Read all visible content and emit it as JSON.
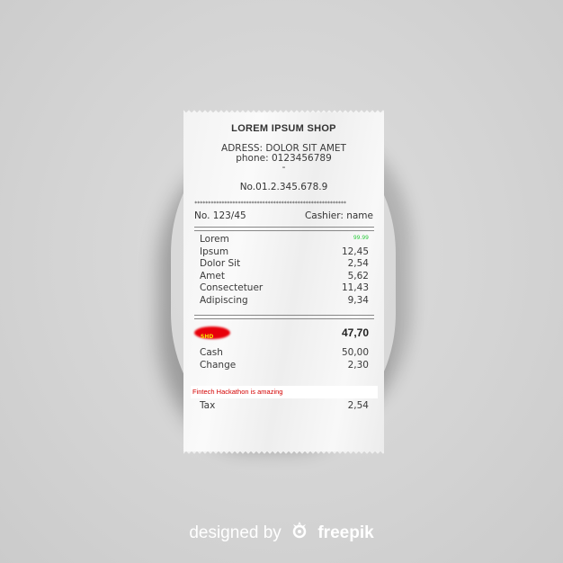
{
  "receipt": {
    "shop_name": "LOREM IPSUM SHOP",
    "address": "ADRESS: DOLOR SIT AMET",
    "phone": "phone: 0123456789",
    "dash": "-",
    "number": "No.01.2.345.678.9",
    "stars": "********************************************************",
    "doc_no": "No. 123/45",
    "cashier": "Cashier: name",
    "items": [
      {
        "name": "Lorem",
        "value": "99.99"
      },
      {
        "name": "Ipsum",
        "value": "12,45"
      },
      {
        "name": "Dolor Sit",
        "value": "2,54"
      },
      {
        "name": "Amet",
        "value": "5,62"
      },
      {
        "name": "Consectetuer",
        "value": "11,43"
      },
      {
        "name": "Adipiscing",
        "value": "9,34"
      }
    ],
    "currency": "SHD",
    "total": "47,70",
    "cash_label": "Cash",
    "cash_value": "50,00",
    "change_label": "Change",
    "change_value": "2,30",
    "promo": "Fintech Hackathon is amazing",
    "tax_label": "Tax",
    "tax_value": "2,54"
  },
  "footer": {
    "designed_by": "designed by",
    "brand": "freepik"
  },
  "colors": {
    "background": "#d4d4d4",
    "paper": "#f3f3f3",
    "highlight_red": "#e8000a",
    "promo_red": "#d40000",
    "value_green": "#2ecc40",
    "currency_yellow": "#f5e400"
  }
}
